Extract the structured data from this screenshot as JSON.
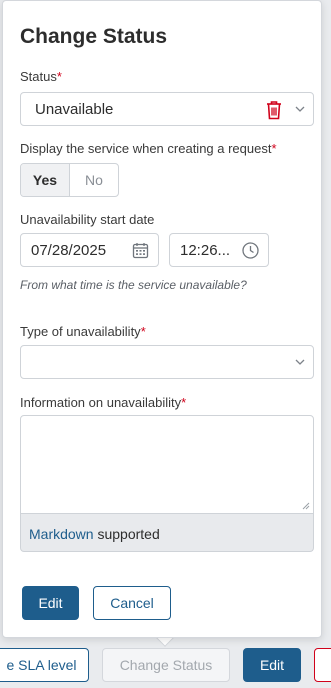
{
  "background_bar": {
    "sla_label": "e SLA level",
    "change_status_label": "Change Status",
    "edit_label": "Edit"
  },
  "dialog": {
    "title": "Change Status",
    "status": {
      "label": "Status",
      "required_mark": "*",
      "value": "Unavailable"
    },
    "display_service": {
      "label": "Display the service when creating a request",
      "required_mark": "*",
      "yes": "Yes",
      "no": "No",
      "selected": "Yes"
    },
    "start_date": {
      "label": "Unavailability start date",
      "date_value": "07/28/2025",
      "time_value": "12:26...",
      "hint": "From what time is the service unavailable?"
    },
    "type": {
      "label": "Type of unavailability",
      "required_mark": "*",
      "value": ""
    },
    "information": {
      "label": "Information on unavailability",
      "required_mark": "*",
      "value": "",
      "markdown_link": "Markdown",
      "markdown_suffix": "supported"
    },
    "actions": {
      "edit_label": "Edit",
      "cancel_label": "Cancel"
    }
  },
  "colors": {
    "primary": "#1e5d8c",
    "required": "#d0021b",
    "trash_icon": "#d0021b"
  },
  "icons": {
    "status_clear": "trash-icon",
    "dropdown": "chevron-down-icon",
    "date": "calendar-icon",
    "time": "clock-icon"
  }
}
